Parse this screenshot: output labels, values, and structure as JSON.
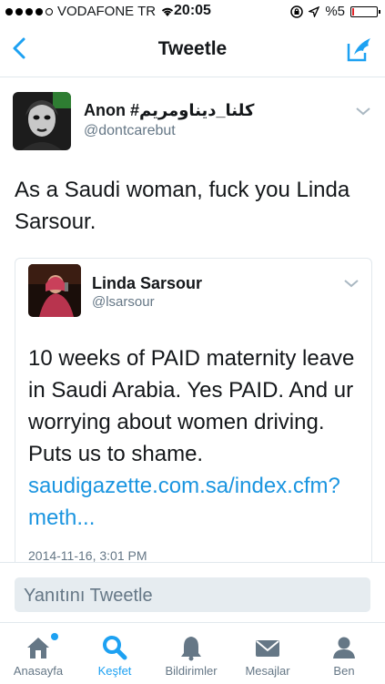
{
  "status_bar": {
    "carrier": "VODAFONE TR",
    "time": "20:05",
    "battery": "%5",
    "battery_level": 0.05
  },
  "nav": {
    "title": "Tweetle",
    "back_icon": "chevron-left-icon",
    "compose_icon": "compose-tweet-icon"
  },
  "tweet": {
    "user_name": "Anon #كلنا_ديناومريم",
    "handle": "@dontcarebut",
    "text": "As a Saudi woman, fuck you Linda Sarsour."
  },
  "quoted_tweet": {
    "user_name": "Linda Sarsour",
    "handle": "@lsarsour",
    "text": "10 weeks of PAID maternity leave in Saudi Arabia. Yes PAID. And ur worrying about women driving. Puts us to shame.",
    "link": "saudigazette.com.sa/index.cfm?meth...",
    "timestamp": "2014-11-16, 3:01 PM"
  },
  "reply": {
    "placeholder": "Yanıtını Tweetle"
  },
  "tabs": [
    {
      "label": "Anasayfa",
      "icon": "home-icon"
    },
    {
      "label": "Keşfet",
      "icon": "search-icon"
    },
    {
      "label": "Bildirimler",
      "icon": "bell-icon"
    },
    {
      "label": "Mesajlar",
      "icon": "envelope-icon"
    },
    {
      "label": "Ben",
      "icon": "person-icon"
    }
  ],
  "colors": {
    "accent": "#1da1f2",
    "link": "#1b95e0",
    "muted": "#657786",
    "battery_low": "#e0262a"
  }
}
